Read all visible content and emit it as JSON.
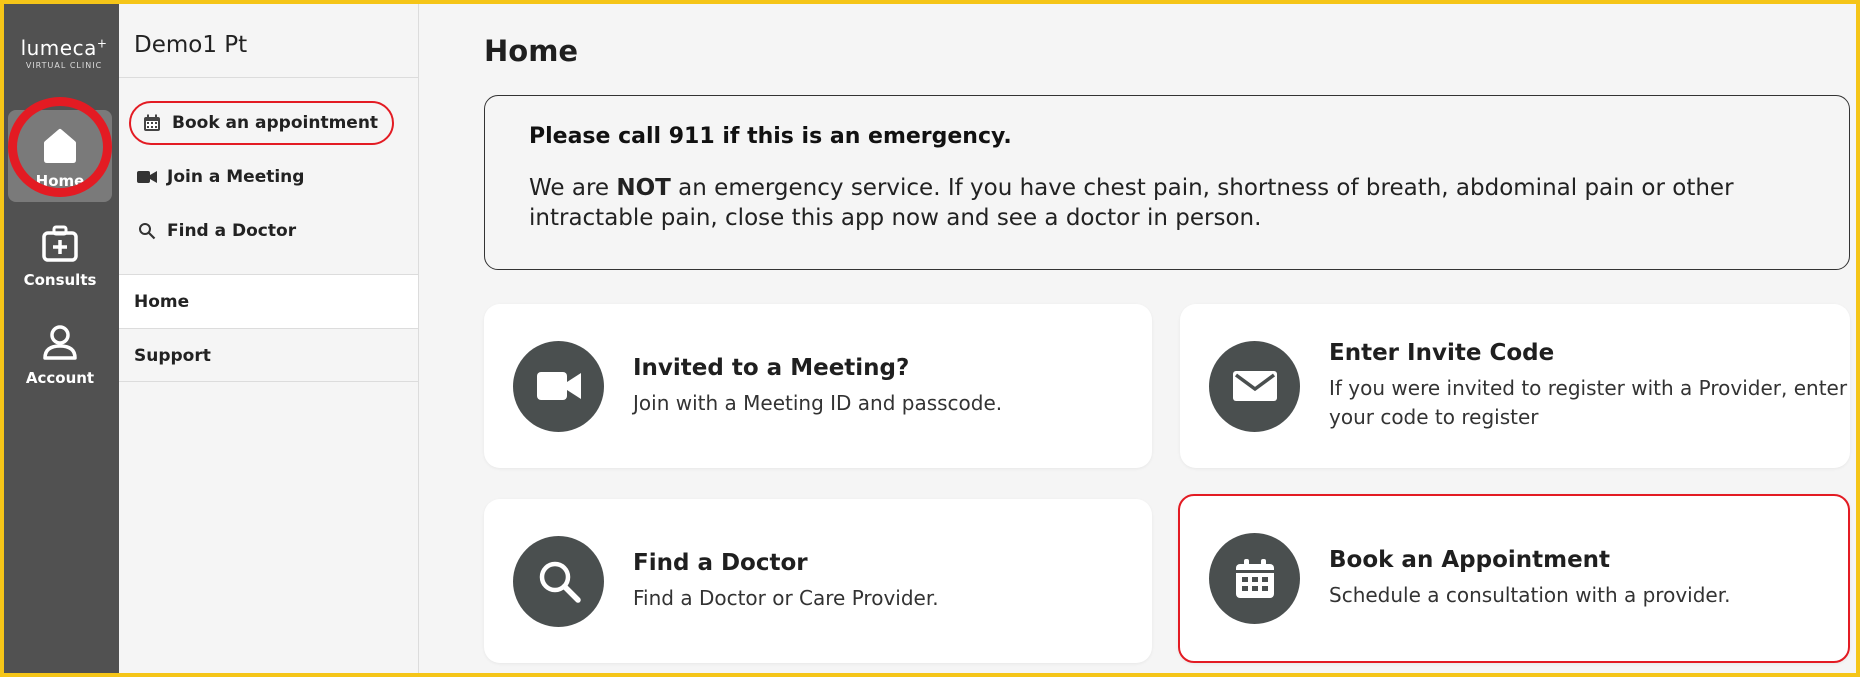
{
  "rail": {
    "logo_text": "lumeca",
    "logo_plus": "+",
    "logo_sub": "VIRTUAL CLINIC",
    "items": [
      {
        "label": "Home",
        "icon": "home-icon"
      },
      {
        "label": "Consults",
        "icon": "medical-kit-icon"
      },
      {
        "label": "Account",
        "icon": "user-icon"
      }
    ]
  },
  "sidebar": {
    "user_name": "Demo1 Pt",
    "links": [
      {
        "label": "Book an appointment",
        "icon": "calendar-icon"
      },
      {
        "label": "Join a Meeting",
        "icon": "video-camera-icon"
      },
      {
        "label": "Find a Doctor",
        "icon": "search-icon"
      }
    ],
    "sections": [
      {
        "label": "Home"
      },
      {
        "label": "Support"
      }
    ]
  },
  "main": {
    "title": "Home",
    "alert": {
      "title": "Please call 911 if this is an emergency.",
      "body_pre": "We are ",
      "body_bold": "NOT",
      "body_post": " an emergency service. If you have chest pain, shortness of breath, abdominal pain or other intractable pain, close this app now and see a doctor in person."
    },
    "cards": [
      {
        "title": "Invited to a Meeting?",
        "desc": "Join with a Meeting ID and passcode.",
        "icon": "video-camera-icon"
      },
      {
        "title": "Enter Invite Code",
        "desc": "If you were invited to register with a Provider, enter your code to register",
        "icon": "envelope-icon"
      },
      {
        "title": "Find a Doctor",
        "desc": "Find a Doctor or Care Provider.",
        "icon": "search-icon"
      },
      {
        "title": "Book an Appointment",
        "desc": "Schedule a consultation with a provider.",
        "icon": "calendar-icon"
      }
    ]
  },
  "colors": {
    "frame": "#f5c518",
    "rail_bg": "#515151",
    "highlight": "#e31b23",
    "icon_circle": "#4a4f4f"
  }
}
